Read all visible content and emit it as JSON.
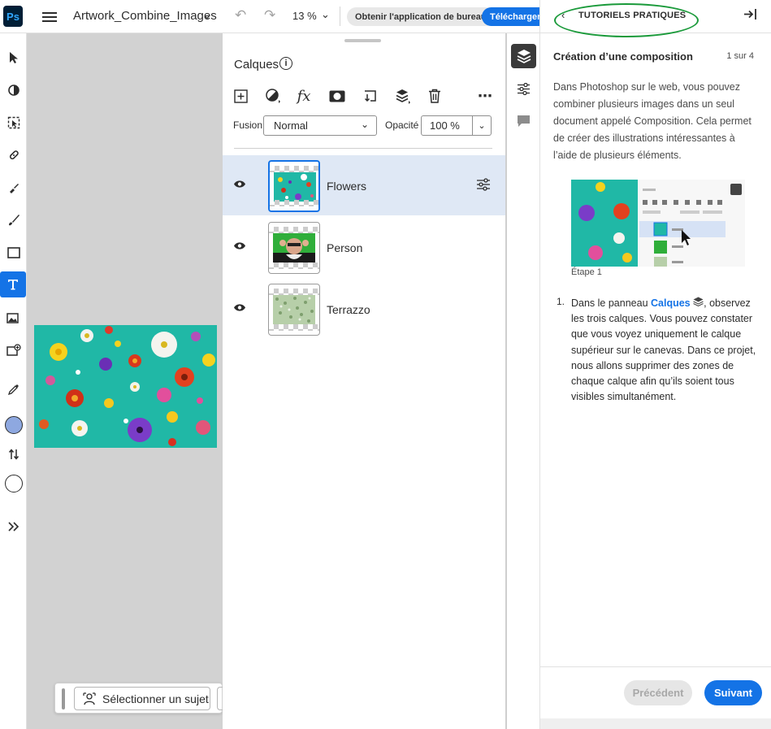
{
  "app": {
    "logo": "Ps",
    "doc_title": "Artwork_Combine_Images",
    "zoom": "13 %",
    "get_app_label": "Obtenir l'application de bureau",
    "download_label": "Télécharger"
  },
  "taskbar": {
    "select_subject_label": "Sélectionner un sujet"
  },
  "layers_panel": {
    "title": "Calques",
    "fusion_label": "Fusion",
    "fusion_value": "Normal",
    "opacity_label": "Opacité",
    "opacity_value": "100 %",
    "layers": [
      {
        "name": "Flowers",
        "selected": true
      },
      {
        "name": "Person",
        "selected": false
      },
      {
        "name": "Terrazzo",
        "selected": false
      }
    ]
  },
  "tutorial": {
    "header": "TUTORIELS PRATIQUES",
    "title": "Création d’une composition",
    "step": "1 sur 4",
    "intro": "Dans Photoshop sur le web, vous pouvez combiner plusieurs images dans un seul document appelé Composition. Cela permet de créer des illustrations intéressantes à l’aide de plusieurs éléments.",
    "image_caption": "Étape 1",
    "list_number": "1.",
    "step_text_before": "Dans le panneau ",
    "step_text_link": "Calques",
    "step_text_after": ", observez les trois calques. Vous pouvez constater que vous voyez uniquement le calque supérieur sur le canevas. Dans ce projet, nous allons supprimer des zones de chaque calque afin qu’ils soient tous visibles simultanément.",
    "prev_label": "Précédent",
    "next_label": "Suivant"
  },
  "colors": {
    "accent": "#1473e6",
    "canvas_bg": "#d2d2d2",
    "artwork_teal": "#20b8a6",
    "selected_row": "#dfe8f5",
    "annotation_green": "#1a9a3a"
  }
}
